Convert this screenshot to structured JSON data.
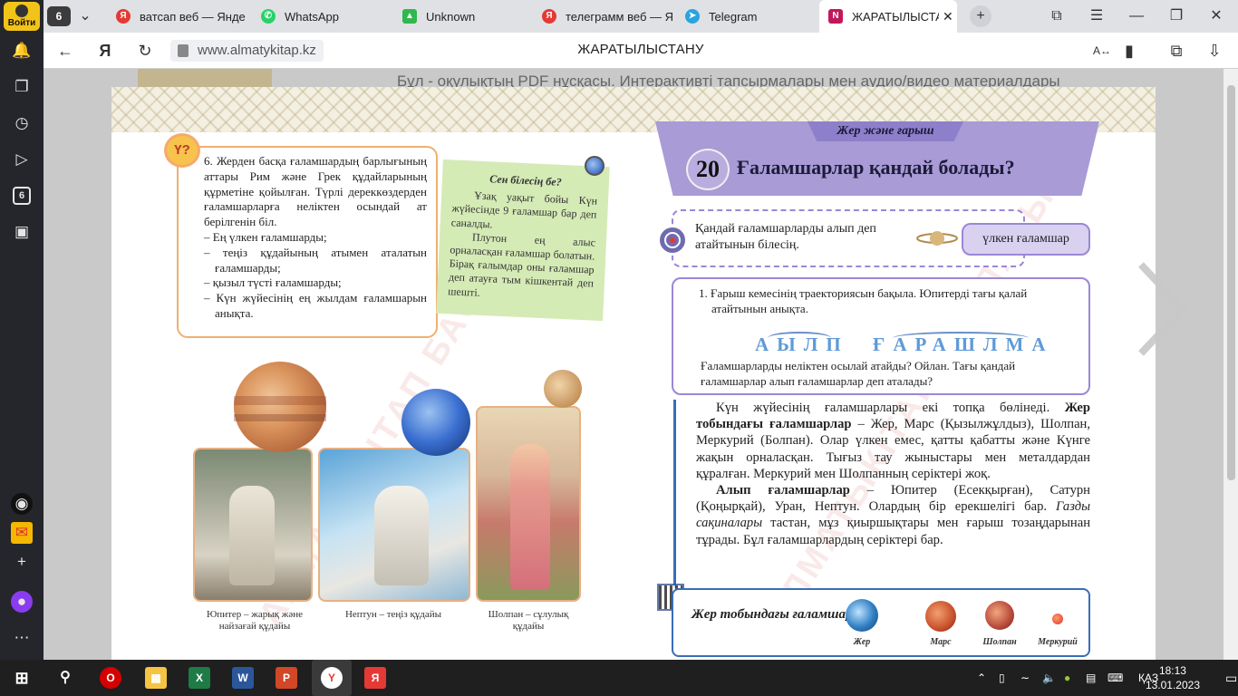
{
  "rail": {
    "login_label": "Войти",
    "tab_counter": "6"
  },
  "tabs": {
    "count": "6",
    "items": [
      {
        "label": "ватсап веб — Янде"
      },
      {
        "label": "WhatsApp"
      },
      {
        "label": "Unknown"
      },
      {
        "label": "телеграмм веб — Я"
      },
      {
        "label": "Telegram"
      },
      {
        "label": "ЖАРАТЫЛЫСТА"
      }
    ]
  },
  "address": {
    "url": "www.almatykitap.kz",
    "page_title": "ЖАРАТЫЛЫСТАНУ"
  },
  "page": {
    "behind_text": "Бұл - оқулықтың PDF нұсқасы. Интерактивті тапсырмалары мен аудио/видео материалдары",
    "badge": "Ү?",
    "task6": {
      "intro": "6. Жерден басқа ғаламшардың барлығының аттары Рим және Грек құдайларының құрметіне қойылған. Түрлі дереккөздерден ғаламшарларға неліктен осындай ат берілгенін біл.",
      "items": [
        "– Ең үлкен ғаламшарды;",
        "– теңіз құдайының атымен аталатын ғаламшарды;",
        "– қызыл түсті ғаламшарды;",
        "– Күн жүйесінің ең жылдам ғаламшарын анықта."
      ]
    },
    "note": {
      "title": "Сен білесің бе?",
      "p1": "Ұзақ уақыт бойы Күн жүйесінде 9 ғаламшар бар деп саналды.",
      "p2": "Плутон ең алыс орналасқан ғаламшар болатын. Бірақ ғалымдар оны ғаламшар деп атауға тым кішкентай деп шешті."
    },
    "captions": {
      "jupiter": "Юпитер – жарық және найзағай құдайы",
      "neptune": "Нептун – теңіз құдайы",
      "venus": "Шолпан – сұлулық құдайы"
    },
    "watermark": "АЛМАТЫКІТАП БАСПАСЫ",
    "section_tab": "Жер және ғарыш",
    "lesson_number": "20",
    "lesson_title": "Ғаламшарлар қандай болады?",
    "question": "Қандай ғаламшарларды алып деп атайтынын білесің.",
    "tag": "үлкен ғаламшар",
    "task1": {
      "text": "1. Ғарыш кемесінің траекториясын бақыла. Юпитерді тағы қалай атайтынын анықта.",
      "word1": "АЫЛП",
      "word2": "ҒАРАШЛМА",
      "q": "Ғаламшарларды неліктен осылай атайды? Ойлан. Тағы қандай ғаламшарлар алып ғаламшарлар деп аталады?"
    },
    "main": {
      "p1_a": "Күн жүйесінің ғаламшарлары екі топқа бөлінеді. ",
      "p1_b": "Жер тобындағы ғаламшарлар",
      "p1_c": " – Жер, Марс (Қызылжұлдыз), Шолпан, Меркурий (Болпан). Олар үлкен емес, қатты қабатты және Күнге жақын орналасқан. Тығыз тау жыныстары мен металдардан құралған. Меркурий мен Шолпанның серіктері жоқ.",
      "p2_a": "Алып ғаламшарлар",
      "p2_b": " – Юпитер (Есекқырған), Сатурн (Қоңырқай), Уран, Нептун. Олардың бір ерекшелігі бар. ",
      "p2_c": "Газды сақиналары",
      "p2_d": " тастан, мұз қиыршықтары мен ғарыш тозаңдарынан тұрады. Бұл ғаламшарлардың серіктері бар."
    },
    "bottom": {
      "label": "Жер тобындағы ғаламшарлар",
      "planets": [
        "Жер",
        "Марс",
        "Шолпан",
        "Меркурий"
      ]
    }
  },
  "taskbar": {
    "lang": "ҚАЗ",
    "time": "18:13",
    "date": "13.01.2023"
  },
  "colors": {
    "accent_purple": "#a89bd6",
    "accent_blue": "#3a6db8",
    "note_green": "#d5ebb6",
    "login_yellow": "#f2c318"
  }
}
